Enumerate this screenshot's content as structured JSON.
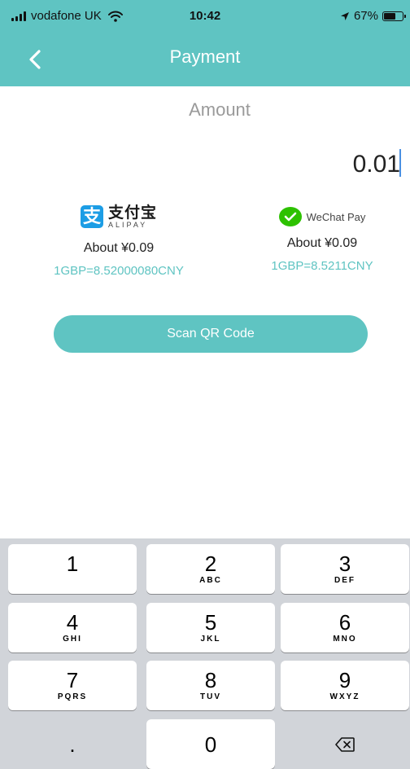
{
  "status_bar": {
    "carrier": "vodafone UK",
    "time": "10:42",
    "battery_percent": "67%",
    "battery_level": 0.67
  },
  "nav": {
    "title": "Payment",
    "back_icon": "chevron-left-icon"
  },
  "amount": {
    "label": "Amount",
    "value": "0.01"
  },
  "providers": {
    "alipay": {
      "logo_cn": "支付宝",
      "logo_en": "ALIPAY",
      "about": "About ¥0.09",
      "rate": "1GBP=8.52000080CNY"
    },
    "wechat": {
      "logo_text": "WeChat Pay",
      "about": "About ¥0.09",
      "rate": "1GBP=8.5211CNY"
    }
  },
  "scan_button": {
    "label": "Scan QR Code"
  },
  "keypad": {
    "keys": [
      {
        "digit": "1",
        "letters": ""
      },
      {
        "digit": "2",
        "letters": "ABC"
      },
      {
        "digit": "3",
        "letters": "DEF"
      },
      {
        "digit": "4",
        "letters": "GHI"
      },
      {
        "digit": "5",
        "letters": "JKL"
      },
      {
        "digit": "6",
        "letters": "MNO"
      },
      {
        "digit": "7",
        "letters": "PQRS"
      },
      {
        "digit": "8",
        "letters": "TUV"
      },
      {
        "digit": "9",
        "letters": "WXYZ"
      },
      {
        "digit": ".",
        "letters": ""
      },
      {
        "digit": "0",
        "letters": ""
      }
    ],
    "delete_icon": "backspace-icon"
  },
  "colors": {
    "accent": "#5fc4c2",
    "keypad_bg": "#d1d4d9",
    "alipay_blue": "#1c9de5",
    "wechat_green": "#2dc100"
  }
}
